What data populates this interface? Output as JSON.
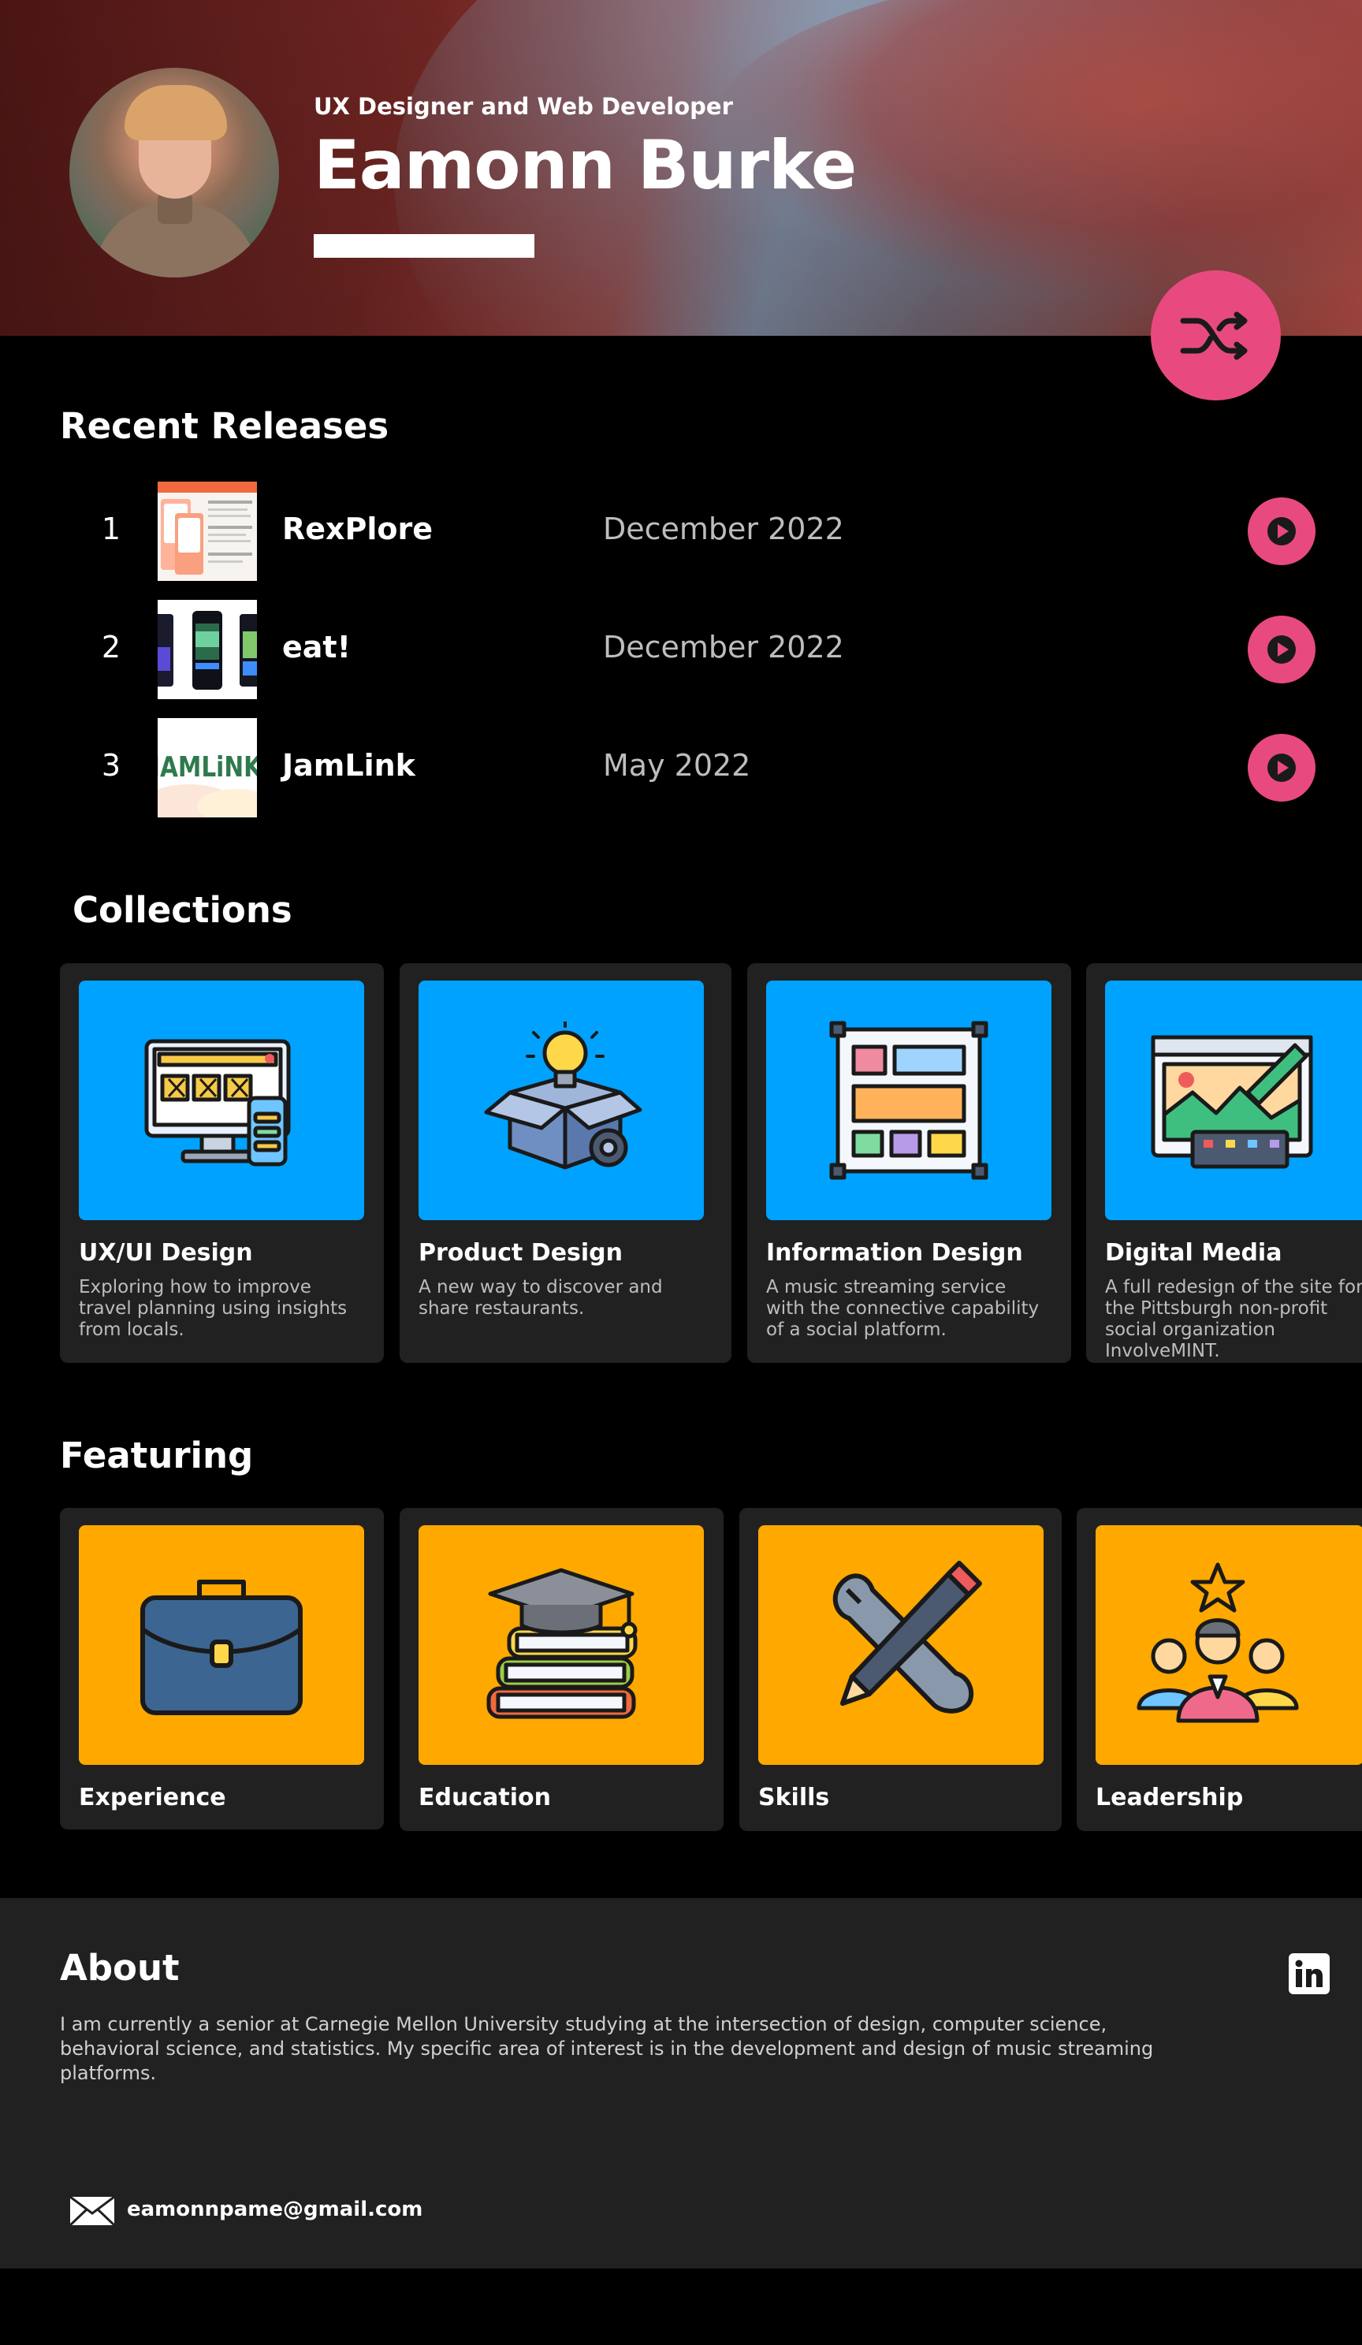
{
  "header": {
    "subtitle": "UX Designer and Web Developer",
    "name": "Eamonn Burke"
  },
  "recent_releases": {
    "title": "Recent Releases",
    "items": [
      {
        "num": "1",
        "title": "RexPlore",
        "date": "December 2022"
      },
      {
        "num": "2",
        "title": "eat!",
        "date": "December 2022"
      },
      {
        "num": "3",
        "title": "JamLink",
        "date": "May 2022"
      }
    ]
  },
  "collections": {
    "title": "Collections",
    "items": [
      {
        "title": "UX/UI Design",
        "desc": "Exploring how to improve travel planning using insights from locals.",
        "icon": "computer-phone-icon"
      },
      {
        "title": "Product Design",
        "desc": "A new way to discover and share restaurants.",
        "icon": "lightbulb-box-icon"
      },
      {
        "title": "Information Design",
        "desc": "A music streaming service with the connective capability of a social platform.",
        "icon": "wireframe-icon"
      },
      {
        "title": "Digital Media",
        "desc": "A full redesign of the site for the Pittsburgh non-profit social organization InvolveMINT.",
        "icon": "drawing-tablet-icon"
      }
    ]
  },
  "featuring": {
    "title": "Featuring",
    "items": [
      {
        "title": "Experience",
        "icon": "briefcase-icon"
      },
      {
        "title": "Education",
        "icon": "graduation-books-icon"
      },
      {
        "title": "Skills",
        "icon": "tools-icon"
      },
      {
        "title": "Leadership",
        "icon": "leader-icon"
      }
    ]
  },
  "about": {
    "title": "About",
    "text": "I am currently a senior at Carnegie Mellon University studying at the intersection of design, computer science, behavioral science, and statistics. My specific area of interest is in the development and design of music streaming platforms.",
    "email": "eamonnpame@gmail.com"
  },
  "thumbnail_text": {
    "jamlink_logo": "JAMLiNK"
  },
  "colors": {
    "accent_pink": "#e84a7f",
    "collection_blue": "#00a2ff",
    "featuring_orange": "#ffa800",
    "card_bg": "#212121"
  }
}
